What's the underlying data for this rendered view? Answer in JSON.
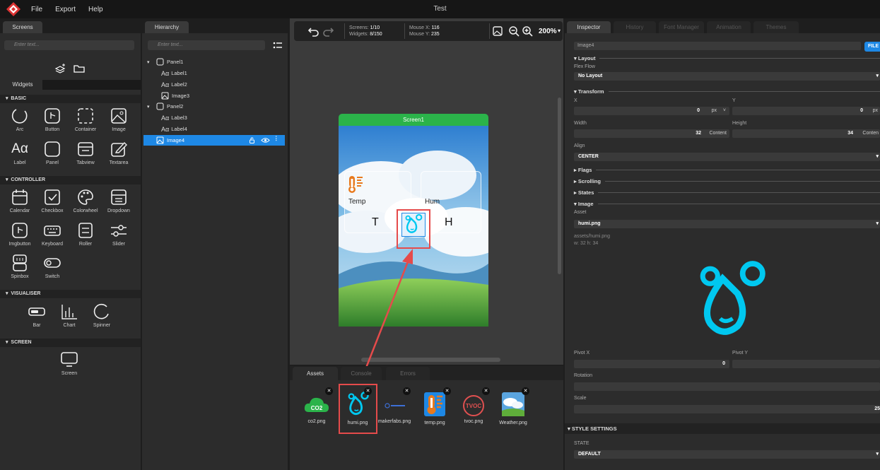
{
  "app": {
    "menu": [
      "File",
      "Export",
      "Help"
    ],
    "title": "Test"
  },
  "left": {
    "tab": "Screens",
    "search_placeholder": "Enter text...",
    "widgets_tab": "Widgets",
    "sections": {
      "basic": "BASIC",
      "controller": "CONTROLLER",
      "visualiser": "VISUALISER",
      "screen": "SCREEN"
    },
    "basic": [
      "Arc",
      "Button",
      "Container",
      "Image",
      "Label",
      "Panel",
      "Tabview",
      "Textarea"
    ],
    "controller": [
      "Calendar",
      "Checkbox",
      "Colorwheel",
      "Dropdown",
      "Imgbutton",
      "Keyboard",
      "Roller",
      "Slider",
      "Spinbox",
      "Switch"
    ],
    "visualiser": [
      "Bar",
      "Chart",
      "Spinner"
    ],
    "screen": [
      "Screen"
    ]
  },
  "hierarchy": {
    "tab": "Hierarchy",
    "search_placeholder": "Enter text...",
    "items": [
      {
        "label": "Panel1"
      },
      {
        "label": "Label1"
      },
      {
        "label": "Label2"
      },
      {
        "label": "Image3"
      },
      {
        "label": "Panel2"
      },
      {
        "label": "Label3"
      },
      {
        "label": "Label4"
      },
      {
        "label": "Image4"
      }
    ]
  },
  "canvas": {
    "screens_label": "Screens:",
    "screens_value": "1/10",
    "widgets_label": "Widgets:",
    "widgets_value": "8/150",
    "mousex_label": "Mouse X:",
    "mousex_value": "116",
    "mousey_label": "Mouse Y:",
    "mousey_value": "235",
    "zoom": "200%",
    "screen_title": "Screen1",
    "temp_label": "Temp",
    "hum_label": "Hum",
    "t_label": "T",
    "h_label": "H"
  },
  "bottom": {
    "tabs": [
      "Assets",
      "Console",
      "Errors"
    ],
    "assets": [
      "co2.png",
      "humi.png",
      "makerfabs.png",
      "temp.png",
      "tvoc.png",
      "Weather.png"
    ]
  },
  "inspector": {
    "tabs": [
      "Inspector",
      "History",
      "Font Manager",
      "Animation",
      "Themes"
    ],
    "name": "Image4",
    "file_btn": "FILE",
    "layout": "Layout",
    "flex_flow_label": "Flex Flow",
    "flex_flow_value": "No Layout",
    "transform": "Transform",
    "x_label": "X",
    "x_value": "0",
    "x_unit": "px",
    "y_label": "Y",
    "y_value": "0",
    "y_unit": "px",
    "width_label": "Width",
    "width_value": "32",
    "width_unit": "Content",
    "height_label": "Height",
    "height_value": "34",
    "height_unit": "Conten",
    "align_label": "Align",
    "align_value": "CENTER",
    "flags": "Flags",
    "scrolling": "Scrolling",
    "states": "States",
    "image": "Image",
    "asset_label": "Asset",
    "asset_value": "humi.png",
    "asset_path": "assets/humi.png",
    "asset_size": "w: 32  h: 34",
    "pivotx_label": "Pivot X",
    "pivotx_value": "0",
    "pivoty_label": "Pivot Y",
    "rotation_label": "Rotation",
    "scale_label": "Scale",
    "scale_value": "25",
    "style_settings": "STYLE SETTINGS",
    "state_label": "STATE",
    "state_value": "DEFAULT"
  },
  "colors": {
    "accent": "#1e88e5",
    "humi": "#00c8f0",
    "green": "#2bb34a",
    "red": "#e05050"
  }
}
